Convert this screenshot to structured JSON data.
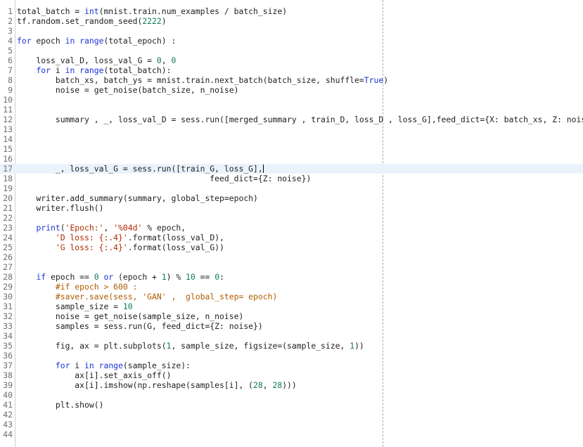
{
  "editor": {
    "colors": {
      "keyword": "#1a34d6",
      "number": "#0b7a5c",
      "string": "#b02a00",
      "comment": "#b05a00",
      "active_line": "#eaf3fb"
    },
    "active_line": 17,
    "lines": [
      {
        "n": "1",
        "t": "total_batch = int(mnist.train.num_examples / batch_size)"
      },
      {
        "n": "2",
        "t": "tf.random.set_random_seed(2222)"
      },
      {
        "n": "3",
        "t": ""
      },
      {
        "n": "4",
        "t": "for epoch in range(total_epoch) :"
      },
      {
        "n": "5",
        "t": ""
      },
      {
        "n": "6",
        "t": "    loss_val_D, loss_val_G = 0, 0"
      },
      {
        "n": "7",
        "t": "    for i in range(total_batch):"
      },
      {
        "n": "8",
        "t": "        batch_xs, batch_ys = mnist.train.next_batch(batch_size, shuffle=True)"
      },
      {
        "n": "9",
        "t": "        noise = get_noise(batch_size, n_noise)"
      },
      {
        "n": "10",
        "t": ""
      },
      {
        "n": "11",
        "t": ""
      },
      {
        "n": "12",
        "t": "        summary , _, loss_val_D = sess.run([merged_summary , train_D, loss_D , loss_G],feed_dict={X: batch_xs, Z: noise})"
      },
      {
        "n": "13",
        "t": ""
      },
      {
        "n": "14",
        "t": ""
      },
      {
        "n": "15",
        "t": ""
      },
      {
        "n": "16",
        "t": ""
      },
      {
        "n": "17",
        "t": "        _, loss_val_G = sess.run([train_G, loss_G],"
      },
      {
        "n": "18",
        "t": "                                        feed_dict={Z: noise})"
      },
      {
        "n": "19",
        "t": ""
      },
      {
        "n": "20",
        "t": "    writer.add_summary(summary, global_step=epoch)"
      },
      {
        "n": "21",
        "t": "    writer.flush()"
      },
      {
        "n": "22",
        "t": ""
      },
      {
        "n": "23",
        "t": "    print('Epoch:', '%04d' % epoch,"
      },
      {
        "n": "24",
        "t": "        'D loss: {:.4}'.format(loss_val_D),"
      },
      {
        "n": "25",
        "t": "        'G loss: {:.4}'.format(loss_val_G))"
      },
      {
        "n": "26",
        "t": ""
      },
      {
        "n": "27",
        "t": ""
      },
      {
        "n": "28",
        "t": "    if epoch == 0 or (epoch + 1) % 10 == 0:"
      },
      {
        "n": "29",
        "t": "        #if epoch > 600 :"
      },
      {
        "n": "30",
        "t": "        #saver.save(sess, 'GAN' ,  global_step= epoch)"
      },
      {
        "n": "31",
        "t": "        sample_size = 10"
      },
      {
        "n": "32",
        "t": "        noise = get_noise(sample_size, n_noise)"
      },
      {
        "n": "33",
        "t": "        samples = sess.run(G, feed_dict={Z: noise})"
      },
      {
        "n": "34",
        "t": ""
      },
      {
        "n": "35",
        "t": "        fig, ax = plt.subplots(1, sample_size, figsize=(sample_size, 1))"
      },
      {
        "n": "36",
        "t": ""
      },
      {
        "n": "37",
        "t": "        for i in range(sample_size):"
      },
      {
        "n": "38",
        "t": "            ax[i].set_axis_off()"
      },
      {
        "n": "39",
        "t": "            ax[i].imshow(np.reshape(samples[i], (28, 28)))"
      },
      {
        "n": "40",
        "t": ""
      },
      {
        "n": "41",
        "t": "        plt.show()"
      },
      {
        "n": "42",
        "t": ""
      },
      {
        "n": "43",
        "t": ""
      },
      {
        "n": "44",
        "t": ""
      }
    ]
  }
}
